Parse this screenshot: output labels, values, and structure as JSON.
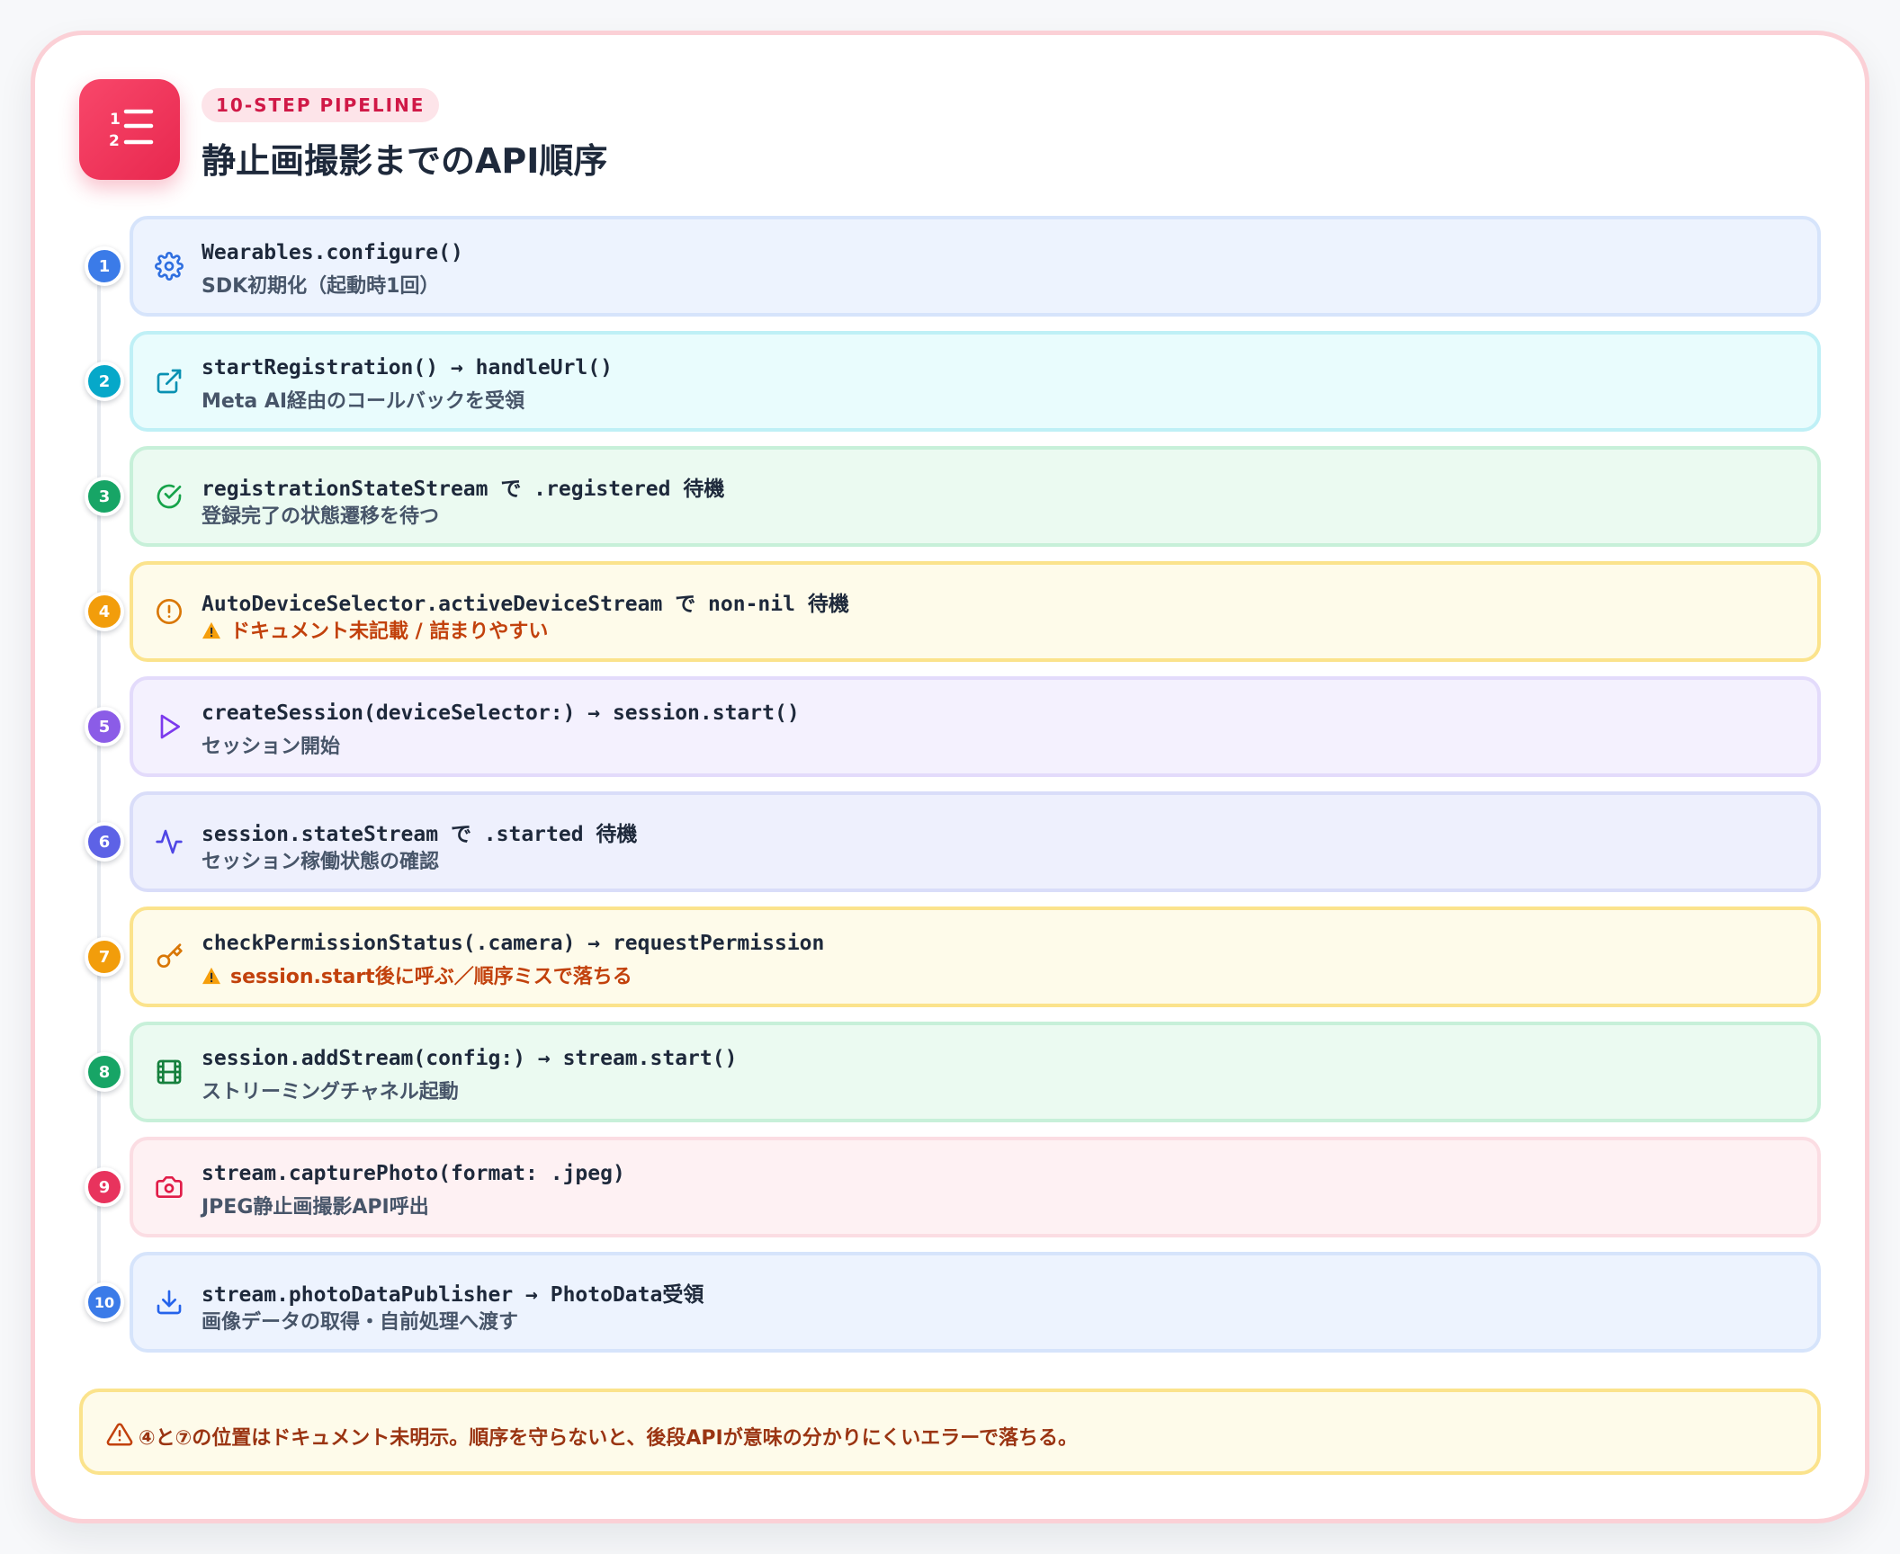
{
  "header": {
    "badge": "10-STEP PIPELINE",
    "title": "静止画撮影までのAPI順序",
    "logo_icon": "numbered-list-icon"
  },
  "steps": [
    {
      "num": "1",
      "code": "Wearables.configure()",
      "desc": "SDK初期化（起動時1回）",
      "icon": "gear-icon",
      "warning": false,
      "accent": "#3b7be8",
      "bg": "#edf3fe",
      "border": "#d6e4fb"
    },
    {
      "num": "2",
      "code": "startRegistration() → handleUrl()",
      "desc": "Meta AI経由のコールバックを受領",
      "icon": "external-link-icon",
      "warning": false,
      "accent": "#06a8c9",
      "bg": "#e9fcfd",
      "border": "#bff0f6"
    },
    {
      "num": "3",
      "code": "registrationStateStream で .registered 待機",
      "desc": "登録完了の状態遷移を待つ",
      "icon": "check-circle-icon",
      "warning": false,
      "accent": "#17a566",
      "bg": "#ebfaf1",
      "border": "#c7f0d9"
    },
    {
      "num": "4",
      "code": "AutoDeviceSelector.activeDeviceStream で non-nil 待機",
      "desc": "ドキュメント未記載 / 詰まりやすい",
      "icon": "alert-circle-icon",
      "warning": true,
      "accent": "#f29d0b",
      "bg": "#fefbea",
      "border": "#fbe38c"
    },
    {
      "num": "5",
      "code": "createSession(deviceSelector:) → session.start()",
      "desc": "セッション開始",
      "icon": "play-icon",
      "warning": false,
      "accent": "#8b5ce7",
      "bg": "#f4f1fe",
      "border": "#e3dbfb"
    },
    {
      "num": "6",
      "code": "session.stateStream で .started 待機",
      "desc": "セッション稼働状態の確認",
      "icon": "activity-icon",
      "warning": false,
      "accent": "#5d62e6",
      "bg": "#eef0fd",
      "border": "#d9ddf9"
    },
    {
      "num": "7",
      "code": "checkPermissionStatus(.camera) → requestPermission",
      "desc": "session.start後に呼ぶ／順序ミスで落ちる",
      "icon": "key-icon",
      "warning": true,
      "accent": "#f29d0b",
      "bg": "#fefbea",
      "border": "#fbe38c"
    },
    {
      "num": "8",
      "code": "session.addStream(config:) → stream.start()",
      "desc": "ストリーミングチャネル起動",
      "icon": "film-icon",
      "warning": false,
      "accent": "#17a566",
      "bg": "#ebfaf1",
      "border": "#c7f0d9"
    },
    {
      "num": "9",
      "code": "stream.capturePhoto(format: .jpeg)",
      "desc": "JPEG静止画撮影API呼出",
      "icon": "camera-icon",
      "warning": false,
      "accent": "#e8335d",
      "bg": "#fef1f3",
      "border": "#fbdde3"
    },
    {
      "num": "10",
      "code": "stream.photoDataPublisher → PhotoData受領",
      "desc": "画像データの取得・自前処理へ渡す",
      "icon": "download-icon",
      "warning": false,
      "accent": "#3b7be8",
      "bg": "#edf3fe",
      "border": "#d6e4fb"
    }
  ],
  "note": {
    "text": "④と⑦の位置はドキュメント未明示。順序を守らないと、後段APIが意味の分かりにくいエラーで落ちる。",
    "icon": "warning-triangle-icon"
  }
}
